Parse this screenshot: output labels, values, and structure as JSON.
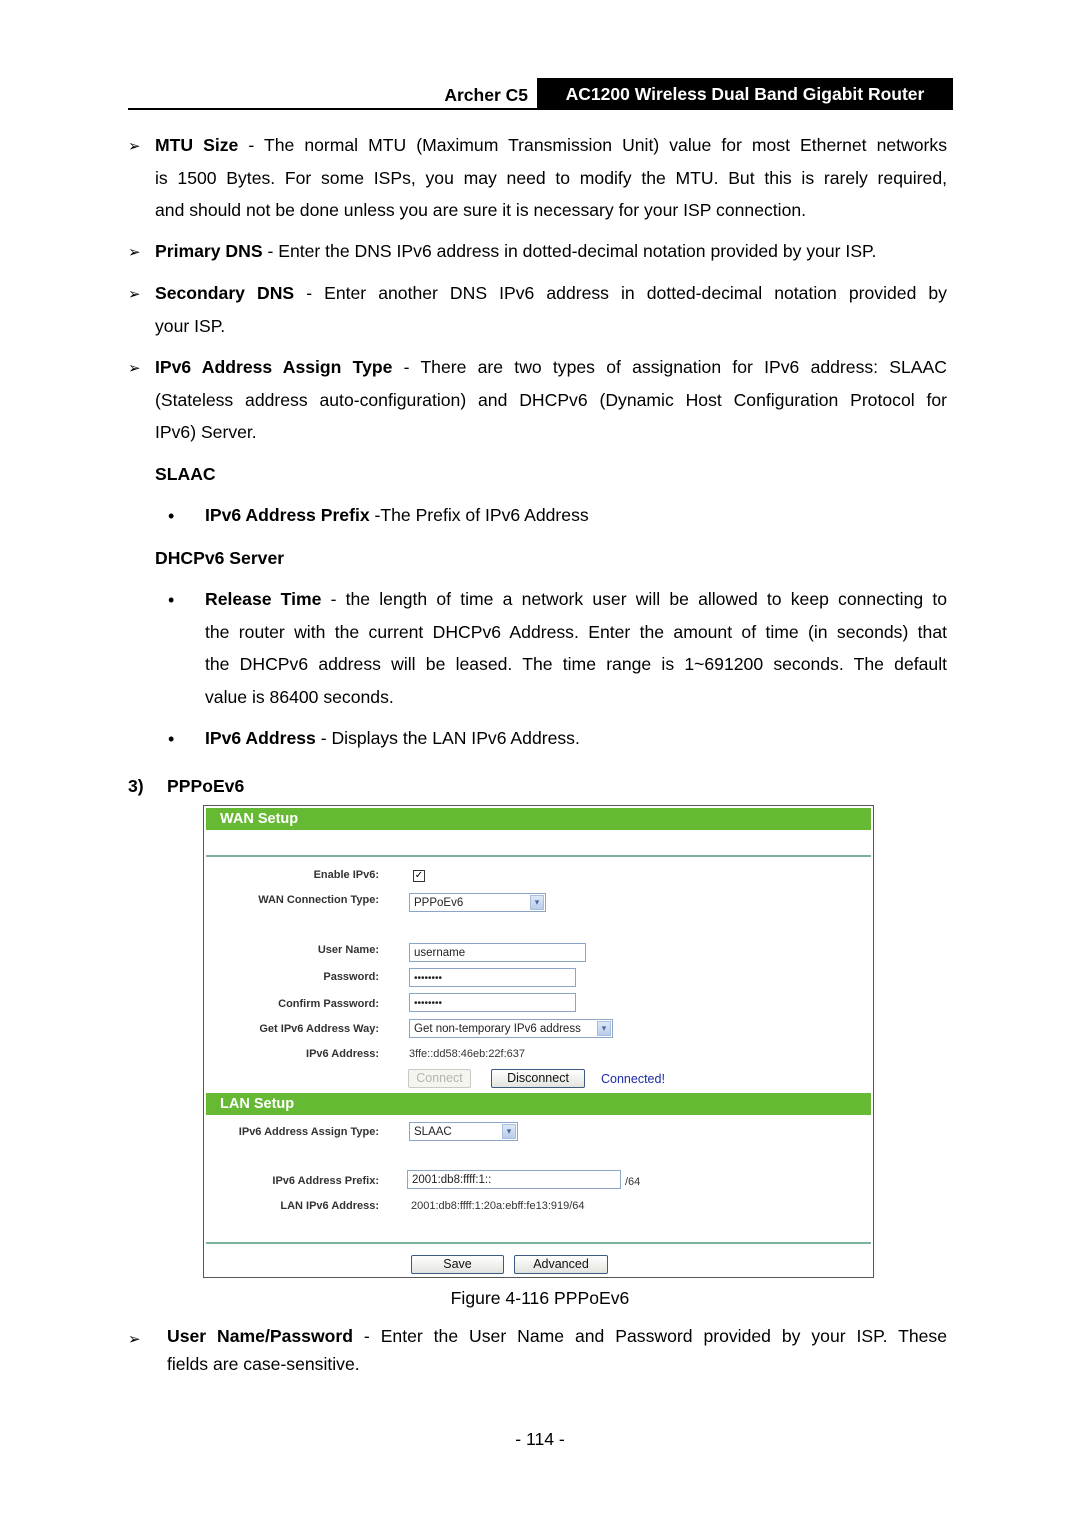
{
  "header": {
    "model": "Archer C5",
    "product": "AC1200 Wireless Dual Band Gigabit Router"
  },
  "items": {
    "mtu": {
      "term": "MTU Size",
      "line1": " - The normal MTU (Maximum Transmission Unit) value for most Ethernet networks",
      "line2": "is 1500 Bytes. For some ISPs, you may need to modify the MTU. But this is rarely required,",
      "line3": "and should not be done unless you are sure it is necessary for your ISP connection."
    },
    "primary_dns": {
      "term": "Primary DNS",
      "line1": " - Enter the DNS IPv6 address in dotted-decimal notation provided by your ISP."
    },
    "secondary_dns": {
      "term": "Secondary DNS",
      "line1": " - Enter another DNS IPv6 address in dotted-decimal notation provided by",
      "line2": "your ISP."
    },
    "assign_type": {
      "term": "IPv6 Address Assign Type",
      "line1": " - There are two types of assignation for IPv6 address: SLAAC",
      "line2": "(Stateless address auto-configuration) and DHCPv6 (Dynamic Host Configuration Protocol for",
      "line3": "IPv6) Server."
    },
    "slaac_heading": "SLAAC",
    "prefix": {
      "term": "IPv6 Address Prefix",
      "desc": " -The Prefix of IPv6 Address"
    },
    "dhcpv6_heading": "DHCPv6 Server",
    "release_time": {
      "term": "Release Time",
      "line1": " - the length of time a network user will be allowed to keep connecting to",
      "line2": "the router with the current DHCPv6 Address. Enter the amount of time (in seconds) that",
      "line3": "the DHCPv6 address will be leased. The time range is 1~691200 seconds. The default",
      "line4": "value is 86400 seconds."
    },
    "ipv6_address": {
      "term": "IPv6 Address",
      "desc": " - Displays the LAN IPv6 Address."
    },
    "section_number": "3)",
    "section_title": "PPPoEv6",
    "user_pass": {
      "term": "User Name/Password",
      "line1": " - Enter the User Name and Password provided by your ISP. These",
      "line2": "fields are case-sensitive."
    }
  },
  "figure": {
    "caption": "Figure 4-116 PPPoEv6",
    "wan": {
      "title": "WAN Setup",
      "enable_ipv6_label": "Enable IPv6:",
      "enable_ipv6_checked": true,
      "check_glyph": "✓",
      "conn_type_label": "WAN Connection Type:",
      "conn_type_value": "PPPoEv6",
      "user_name_label": "User Name:",
      "user_name_value": "username",
      "password_label": "Password:",
      "password_value": "••••••••",
      "confirm_label": "Confirm Password:",
      "confirm_value": "••••••••",
      "addr_way_label": "Get IPv6 Address Way:",
      "addr_way_value": "Get non-temporary IPv6 address",
      "ipv6_addr_label": "IPv6 Address:",
      "ipv6_addr_value": "3ffe::dd58:46eb:22f:637",
      "connect_label": "Connect",
      "disconnect_label": "Disconnect",
      "status": "Connected!",
      "status_color": "#1a2aa8"
    },
    "lan": {
      "title": "LAN Setup",
      "assign_label": "IPv6 Address Assign Type:",
      "assign_value": "SLAAC",
      "prefix_label": "IPv6 Address Prefix:",
      "prefix_value": "2001:db8:ffff:1::",
      "prefix_suffix": "/64",
      "lan_addr_label": "LAN IPv6 Address:",
      "lan_addr_value": "2001:db8:ffff:1:20a:ebff:fe13:919/64"
    },
    "save_label": "Save",
    "advanced_label": "Advanced",
    "dropdown_glyph": "▾",
    "accent": "#66b933"
  },
  "bullet_arrow": "➢",
  "bullet_dot": "•",
  "page_number": "- 114 -"
}
